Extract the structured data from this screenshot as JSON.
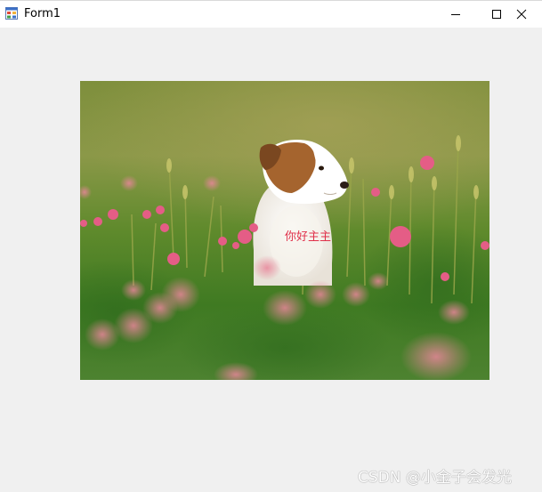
{
  "window": {
    "title": "Form1",
    "controls": {
      "minimize_icon": "minimize-icon",
      "maximize_icon": "maximize-icon",
      "close_icon": "close-icon"
    }
  },
  "picture": {
    "subject": "puppy-in-flower-field-photo",
    "overlay_text": "你好主主"
  },
  "watermark": {
    "text": "CSDN @小金子会发光"
  },
  "colors": {
    "window_bg": "#f0f0f0",
    "titlebar_bg": "#ffffff",
    "overlay_text": "#e0304a"
  }
}
